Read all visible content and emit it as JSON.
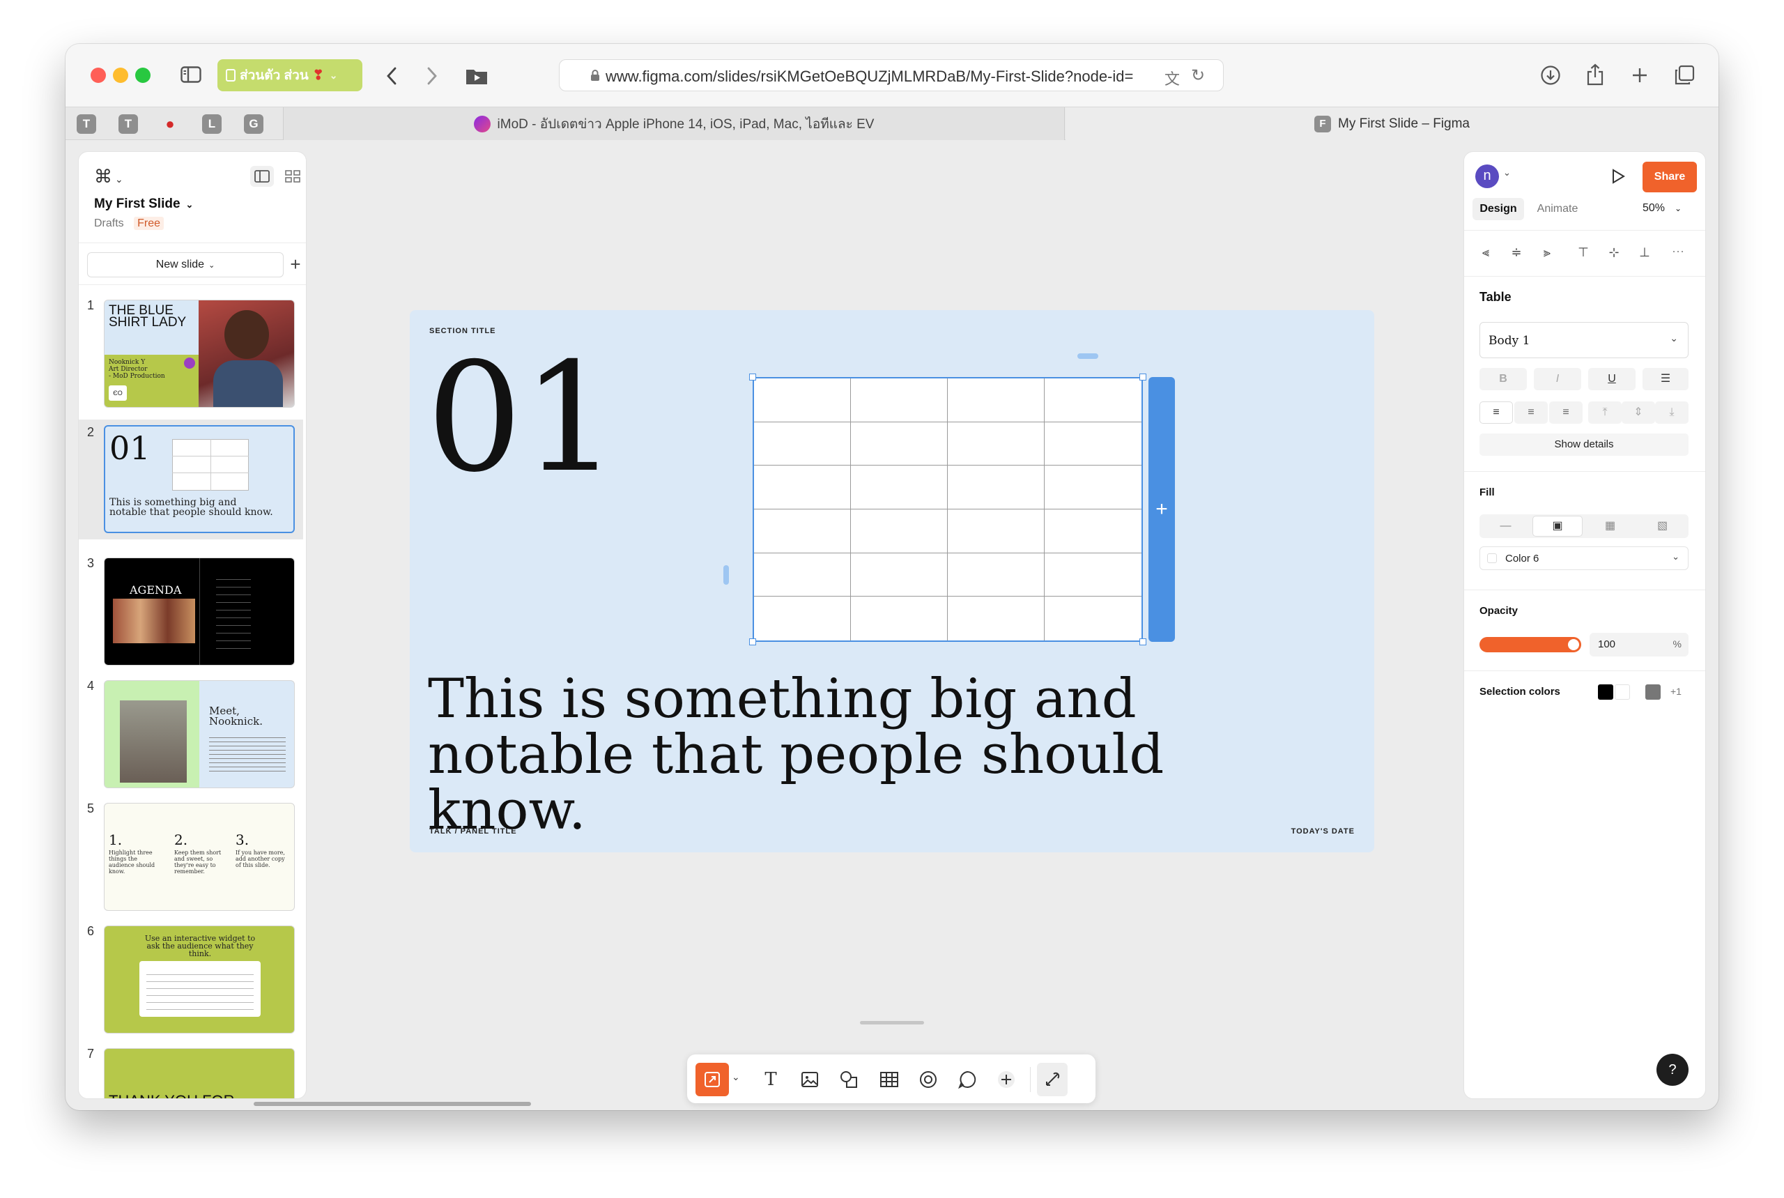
{
  "browser": {
    "url": "www.figma.com/slides/rsiKMGetOeBQUZjMLMRDaB/My-First-Slide?node-id=",
    "tab_group_label": "ส่วนตัว ส่วน",
    "pinned_tabs": [
      "T",
      "T",
      "",
      "L",
      "G"
    ],
    "tabs": [
      {
        "title": "iMoD - อัปเดตข่าว Apple iPhone 14, iOS, iPad, Mac, ไอทีและ EV"
      },
      {
        "title": "My First Slide – Figma",
        "favicon": "F"
      }
    ]
  },
  "left_panel": {
    "file_name": "My First Slide",
    "location": "Drafts",
    "plan_badge": "Free",
    "new_slide_label": "New slide",
    "slides": [
      {
        "n": "1",
        "title_a": "THE BLUE",
        "title_b": "SHIRT LADY",
        "sub": "Nooknick Y\nArt Director\n- MoD Production"
      },
      {
        "n": "2",
        "big": "01",
        "body": "This is something big and notable that people should know."
      },
      {
        "n": "3",
        "title": "AGENDA"
      },
      {
        "n": "4",
        "title": "Meet, Nooknick."
      },
      {
        "n": "5",
        "items": [
          "1.",
          "2.",
          "3."
        ],
        "texts": [
          "Highlight three things the audience should know.",
          "Keep them short and sweet, so they're easy to remember.",
          "If you have more, add another copy of this slide."
        ]
      },
      {
        "n": "6",
        "title": "Use an interactive widget to ask the audience what they think."
      },
      {
        "n": "7",
        "title": "THANK YOU FOR"
      }
    ]
  },
  "slide": {
    "section_title": "SECTION TITLE",
    "number": "01",
    "body": "This is something big and notable that people should know.",
    "footer_left": "TALK / PANEL TITLE",
    "footer_right": "TODAY'S DATE",
    "bg_color": "#dbe9f7",
    "table": {
      "rows": 6,
      "cols": 4
    }
  },
  "right_panel": {
    "avatar": "n",
    "share": "Share",
    "tab_design": "Design",
    "tab_animate": "Animate",
    "zoom": "50%",
    "section_table": "Table",
    "text_style": "Body 1",
    "show_details": "Show details",
    "section_fill": "Fill",
    "fill_color": "Color 6",
    "section_opacity": "Opacity",
    "opacity_value": "100",
    "opacity_unit": "%",
    "opacity_fraction": 1.0,
    "selection_colors_label": "Selection colors",
    "selection_colors_more": "+1",
    "selection_colors": [
      "#000000",
      "#ffffff",
      "#777777"
    ]
  },
  "bottom_toolbar": {
    "tools": [
      "slide-tool",
      "text-tool",
      "image-tool",
      "shape-tool",
      "table-tool",
      "stamp-tool",
      "comment-tool",
      "plus-tool",
      "annotate-tool"
    ]
  },
  "help": "?",
  "colors": {
    "accent": "#f0622b",
    "selection": "#4a90e2",
    "tab_group": "#c5dc6d"
  }
}
